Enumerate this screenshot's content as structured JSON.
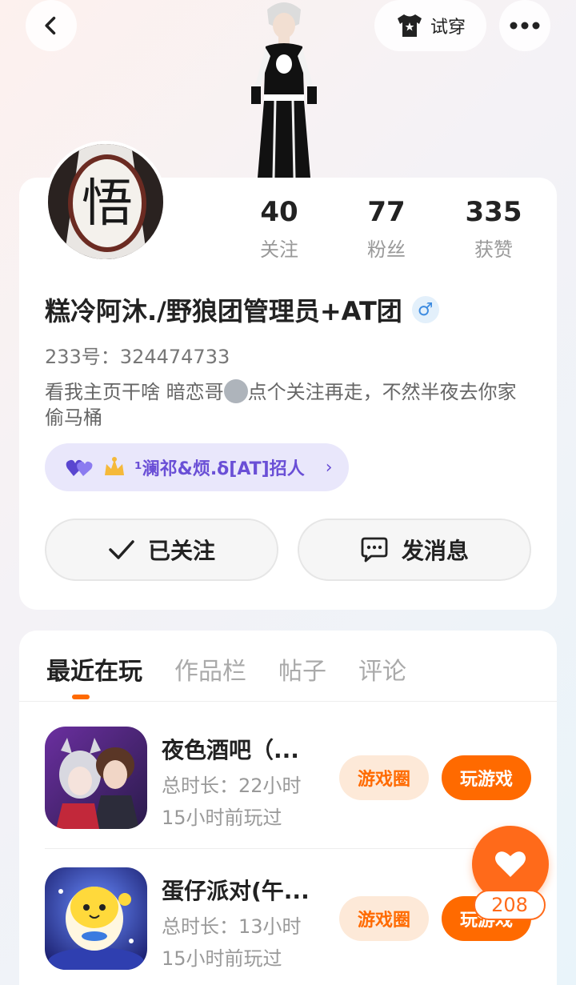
{
  "header": {
    "tryon_label": "试穿"
  },
  "stats": [
    {
      "value": "40",
      "label": "关注"
    },
    {
      "value": "77",
      "label": "粉丝"
    },
    {
      "value": "335",
      "label": "获赞"
    }
  ],
  "profile": {
    "nickname": "糕冷阿沐./野狼团管理员+AT团",
    "gender_symbol": "♂",
    "uid": "233号：324474733",
    "bio_part1": "看我主页干啥 暗恋哥",
    "bio_part2": "点个关注再走，不然半夜去你家偷马桶",
    "group_tag": "¹澜祁&烦.δ[AT]招人",
    "avatar_glyph": "悟"
  },
  "actions": {
    "follow_label": "已关注",
    "message_label": "发消息"
  },
  "tabs": [
    "最近在玩",
    "作品栏",
    "帖子",
    "评论"
  ],
  "games": [
    {
      "title": "夜色酒吧（...",
      "duration": "总时长：22小时",
      "last_played": "15小时前玩过",
      "circle_label": "游戏圈",
      "play_label": "玩游戏"
    },
    {
      "title": "蛋仔派对(午...",
      "duration": "总时长：13小时",
      "last_played": "15小时前玩过",
      "circle_label": "游戏圈",
      "play_label": "玩游戏"
    }
  ],
  "likes": {
    "count": "208"
  },
  "colors": {
    "accent": "#ff6a00",
    "group_tag": "#6a4fd6",
    "gender": "#3d8be0"
  }
}
